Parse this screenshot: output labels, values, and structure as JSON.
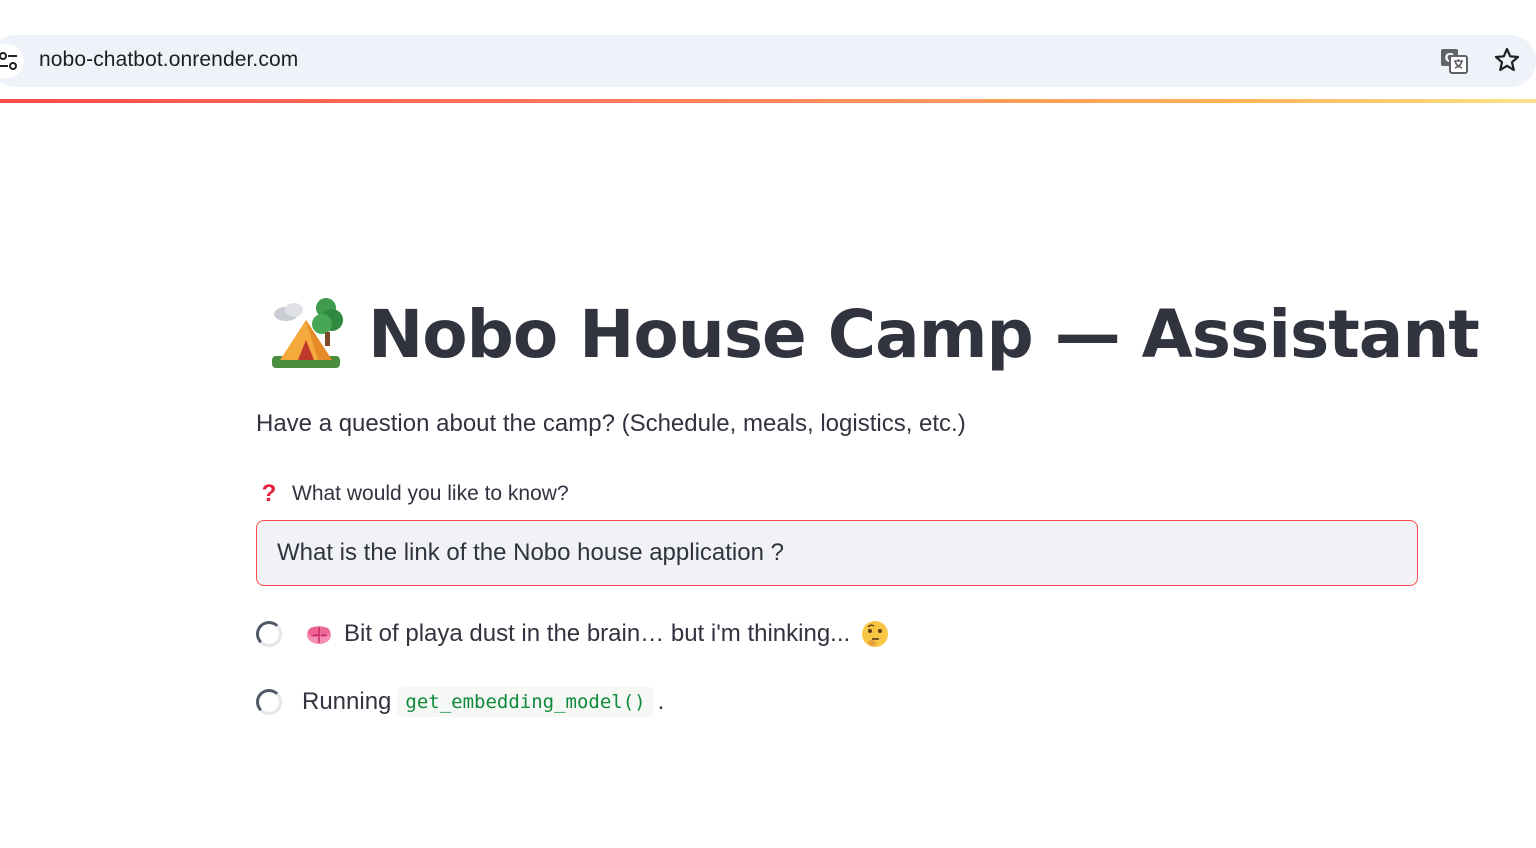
{
  "browser": {
    "url": "nobo-chatbot.onrender.com",
    "icons": [
      "site-info-icon",
      "translate-icon",
      "bookmark-star-icon"
    ]
  },
  "app": {
    "title_emoji": "camping-tent-icon",
    "title": "Nobo House Camp — Assistant",
    "subtitle": "Have a question about the camp? (Schedule, meals, logistics, etc.)",
    "input": {
      "label_icon": "question-mark-icon",
      "label": "What would you like to know?",
      "value": "What is the link of the Nobo house application ?"
    },
    "status": {
      "thinking_icon": "brain-icon",
      "thinking_text": "Bit of playa dust in the brain… but i'm thinking...",
      "thinking_emoji": "thinking-face-icon",
      "running_prefix": "Running",
      "running_code": "get_embedding_model()",
      "running_suffix": "."
    },
    "colors": {
      "accent": "#ff4b4b",
      "text": "#31333f",
      "code": "#0f8a3a"
    }
  }
}
